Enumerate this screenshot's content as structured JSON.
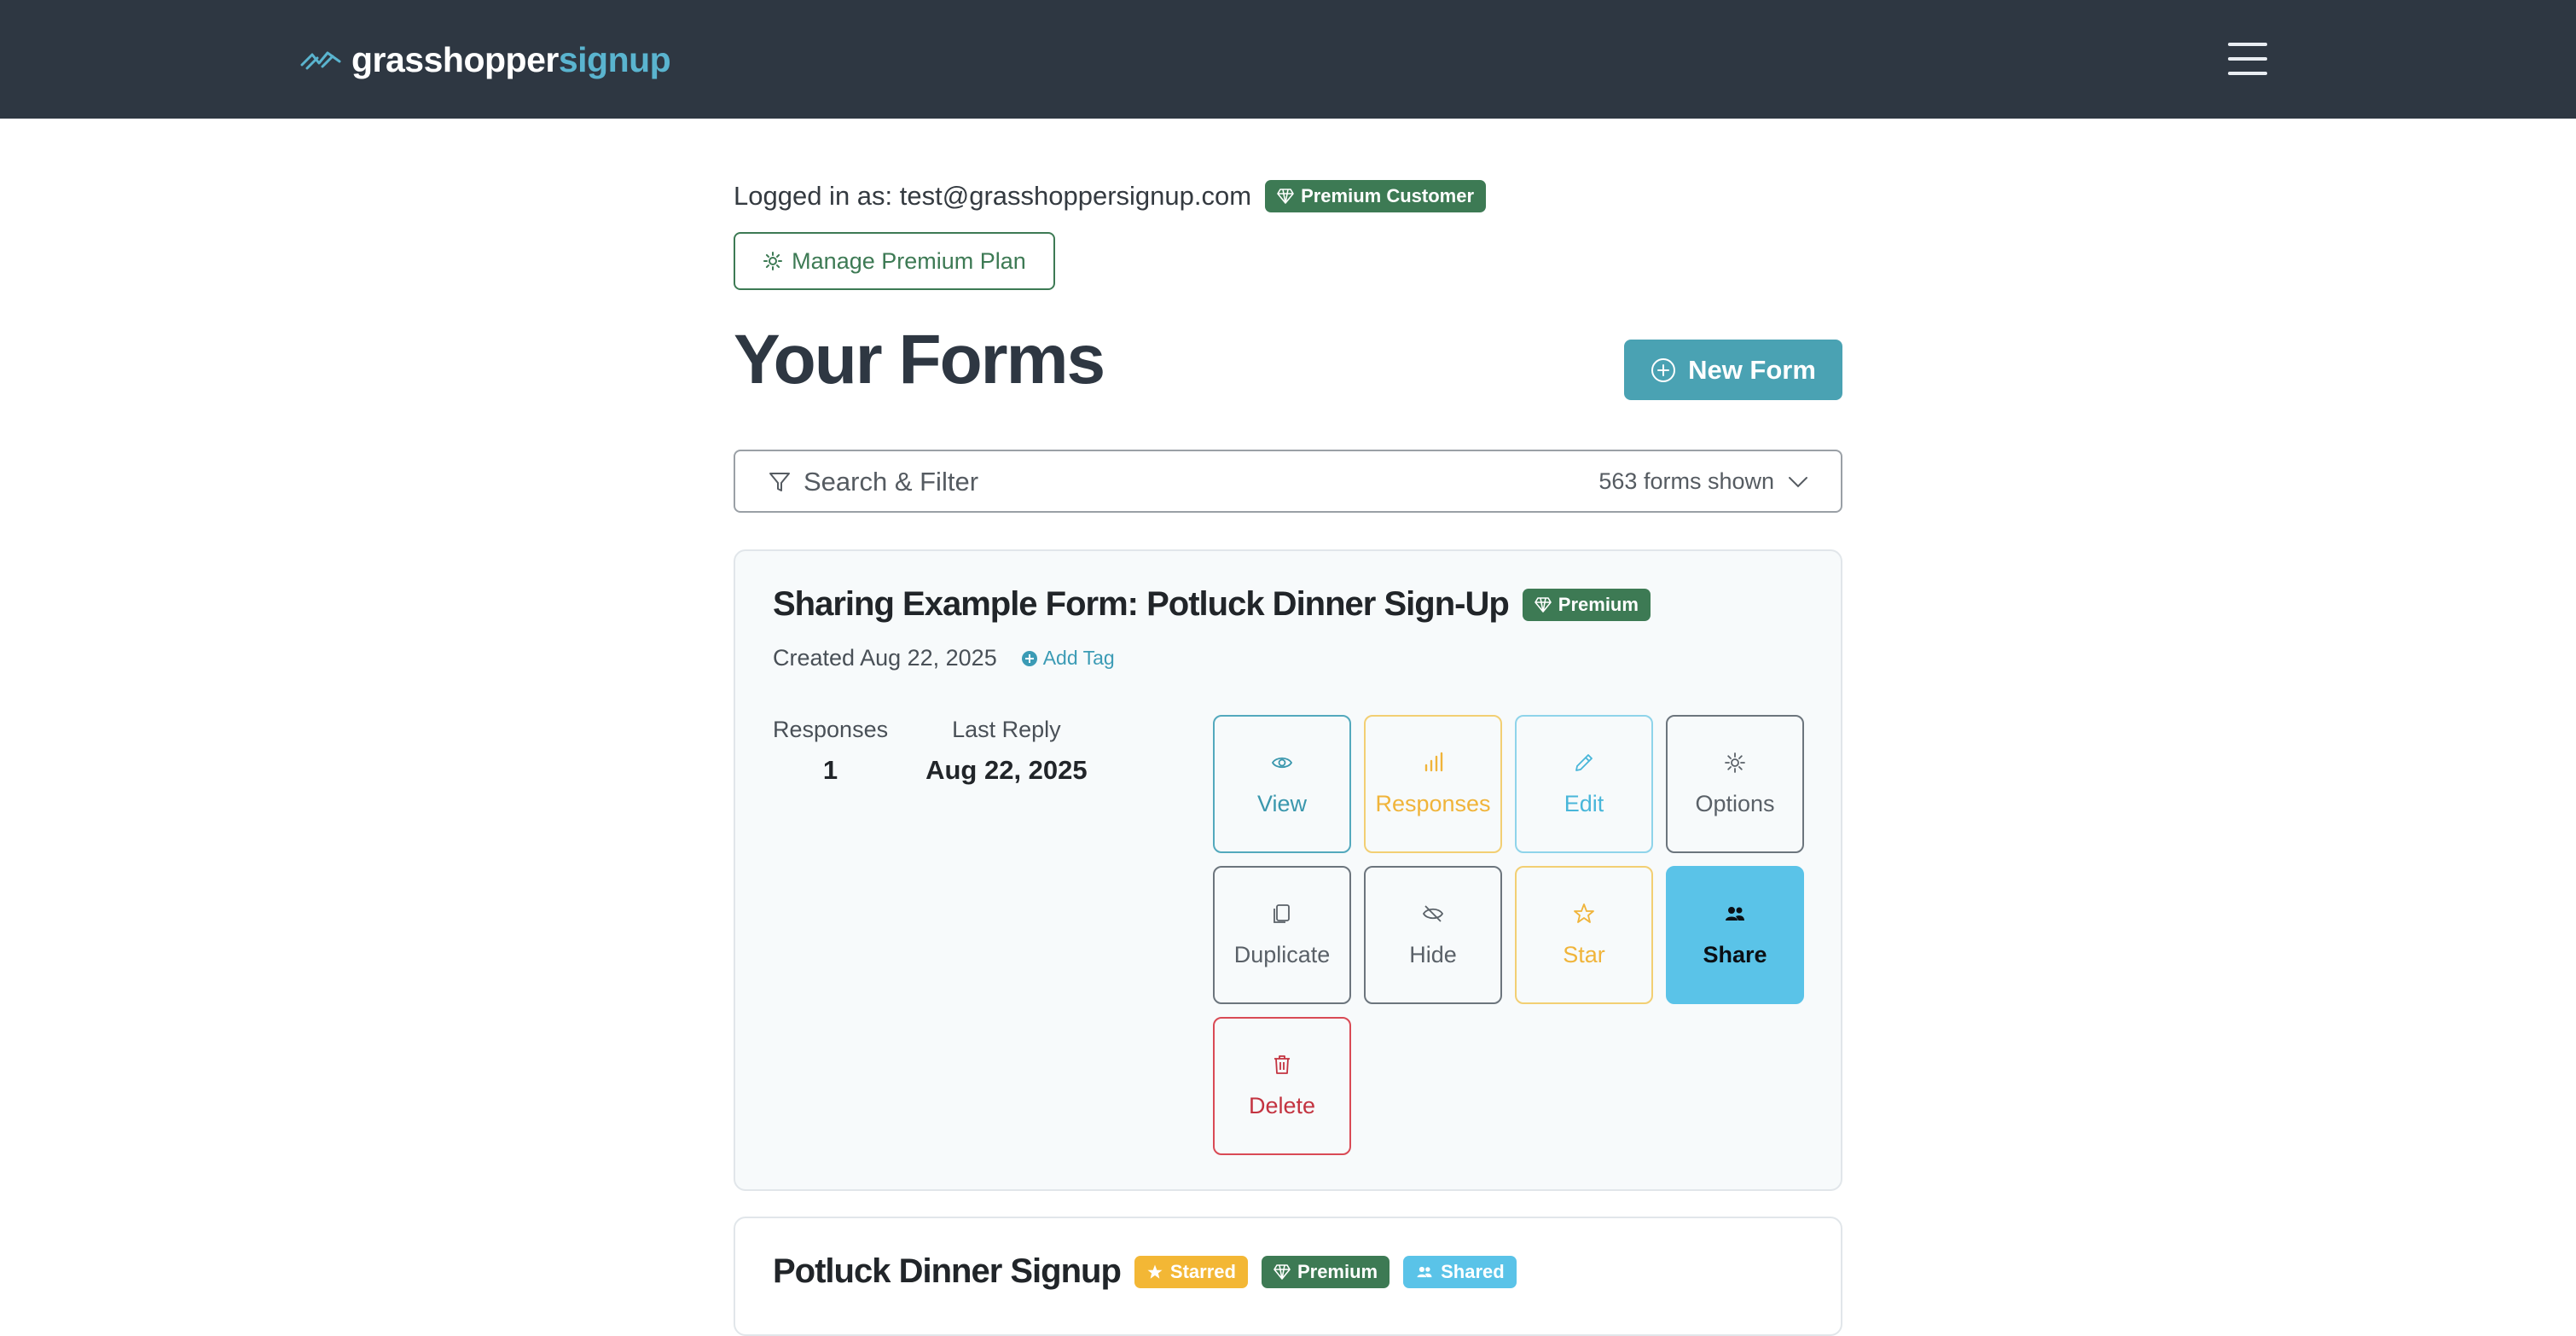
{
  "navbar": {
    "brand_part1": "grasshopper",
    "brand_part2": "signup",
    "colors": {
      "bg": "#2e3742",
      "accent": "#5ab4cf"
    }
  },
  "account": {
    "logged_in_text": "Logged in as: test@grasshoppersignup.com",
    "premium_badge": "Premium Customer",
    "manage_button": "Manage Premium Plan"
  },
  "page": {
    "title": "Your Forms",
    "new_form_button": "New Form"
  },
  "search": {
    "label": "Search & Filter",
    "count_text": "563 forms shown"
  },
  "forms": [
    {
      "title": "Sharing Example Form: Potluck Dinner Sign-Up",
      "badges": {
        "premium": "Premium"
      },
      "created": "Created Aug 22, 2025",
      "add_tag": "Add Tag",
      "stats": {
        "responses_label": "Responses",
        "responses_value": "1",
        "last_reply_label": "Last Reply",
        "last_reply_value": "Aug 22, 2025"
      },
      "actions": {
        "view": "View",
        "responses": "Responses",
        "edit": "Edit",
        "options": "Options",
        "duplicate": "Duplicate",
        "hide": "Hide",
        "star": "Star",
        "share": "Share",
        "delete": "Delete"
      }
    },
    {
      "title": "Potluck Dinner Signup",
      "badges": {
        "starred": "Starred",
        "premium": "Premium",
        "shared": "Shared"
      }
    }
  ]
}
